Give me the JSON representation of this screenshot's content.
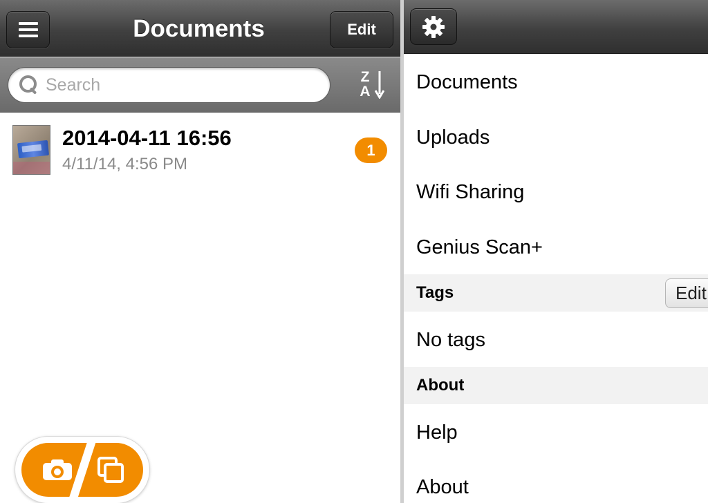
{
  "left_pane": {
    "navbar": {
      "title": "Documents",
      "edit_label": "Edit",
      "menu_icon": "hamburger-menu-icon"
    },
    "search": {
      "placeholder": "Search",
      "value": "",
      "sort_top_letter": "Z",
      "sort_bottom_letter": "A",
      "sort_icon": "sort-z-a-icon"
    },
    "documents": [
      {
        "title": "2014-04-11 16:56",
        "date": "4/11/14, 4:56 PM",
        "page_count": "1"
      }
    ],
    "capture_buttons": {
      "camera_icon": "camera-icon",
      "pages_icon": "multi-page-icon"
    }
  },
  "right_pane": {
    "settings_icon": "gear-icon",
    "menu_items": [
      "Documents",
      "Uploads",
      "Wifi Sharing",
      "Genius Scan+"
    ],
    "tags_section": {
      "header": "Tags",
      "edit_label": "Edit",
      "items": [
        "No tags"
      ]
    },
    "about_section": {
      "header": "About",
      "items": [
        "Help",
        "About"
      ]
    }
  },
  "colors": {
    "accent_orange": "#f28c00",
    "navbar_dark": "#404040",
    "section_gray": "#f2f2f2",
    "secondary_text": "#8a8a8a"
  }
}
